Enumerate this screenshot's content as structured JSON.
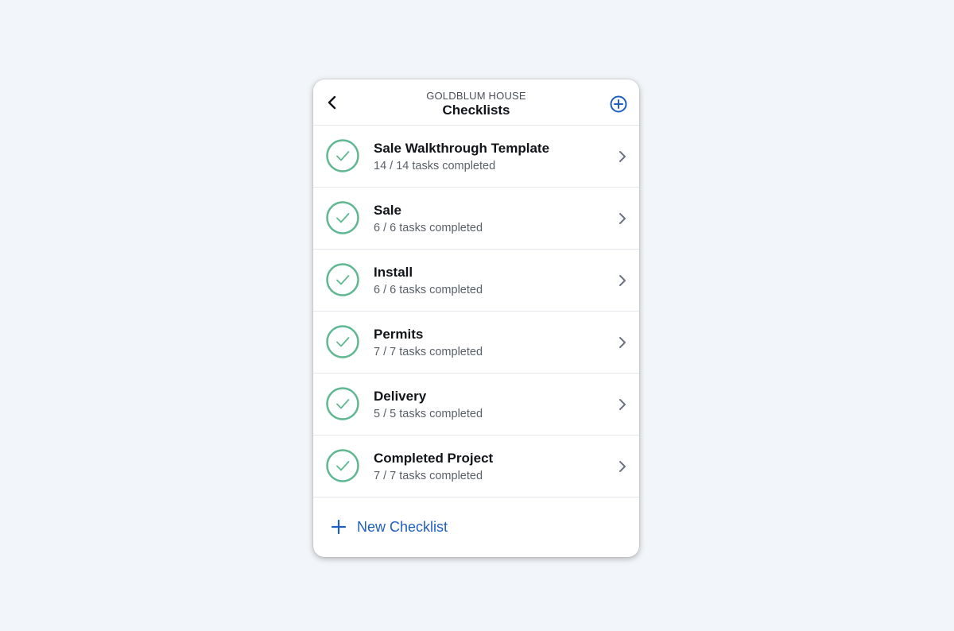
{
  "header": {
    "project_name": "GOLDBLUM HOUSE",
    "title": "Checklists",
    "back_icon": "chevron-left-icon",
    "add_icon": "plus-circle-icon"
  },
  "checklists": [
    {
      "title": "Sale Walkthrough Template",
      "progress": "14 / 14 tasks completed"
    },
    {
      "title": "Sale",
      "progress": "6 / 6 tasks completed"
    },
    {
      "title": "Install",
      "progress": "6 / 6 tasks completed"
    },
    {
      "title": "Permits",
      "progress": "7 / 7 tasks completed"
    },
    {
      "title": "Delivery",
      "progress": "5 / 5 tasks completed"
    },
    {
      "title": "Completed Project",
      "progress": "7 / 7 tasks completed"
    }
  ],
  "footer": {
    "new_label": "New Checklist"
  },
  "colors": {
    "accent": "#1f5fbf",
    "complete": "#5fb892",
    "background": "#f2f5f9"
  }
}
